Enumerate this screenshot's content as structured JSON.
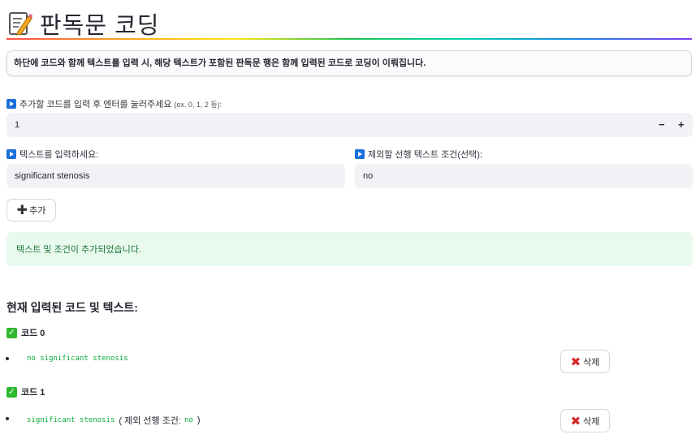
{
  "page": {
    "title": "판독문 코딩",
    "title_icon": "memo-icon",
    "info": "하단에 코드와 함께 텍스트를 입력 시, 해당 텍스트가 포함된 판독문 행은 함께 입력된 코드로 코딩이 이뤄집니다."
  },
  "form": {
    "code_label": "추가할 코드를 입력 후 엔터를 눌러주세요",
    "code_hint": "(ex. 0, 1, 2 등):",
    "code_value": "1",
    "minus": "−",
    "plus": "+",
    "text_label": "텍스트를 입력하세요:",
    "text_value": "significant stenosis",
    "exclude_label": "제외할 선행 텍스트 조건(선택):",
    "exclude_value": "no",
    "add_label": "추가",
    "add_icon": "plus-icon"
  },
  "success_message": "텍스트 및 조건이 추가되었습니다.",
  "current": {
    "header": "현재 입력된 코드 및 텍스트:",
    "codes": [
      {
        "label": "코드 0",
        "text": "no significant stenosis",
        "condition_label": "",
        "condition": "",
        "delete_label": "삭제"
      },
      {
        "label": "코드 1",
        "text": "significant stenosis",
        "condition_label": "( 제외 선행 조건:",
        "condition": "no",
        "close": ")",
        "delete_label": "삭제"
      }
    ]
  },
  "colors": {
    "accent": "#1a6fd9",
    "success_bg": "#e8f9ee",
    "success_text": "#177233",
    "code_green": "#09ab3b",
    "delete_red": "#d62728"
  }
}
